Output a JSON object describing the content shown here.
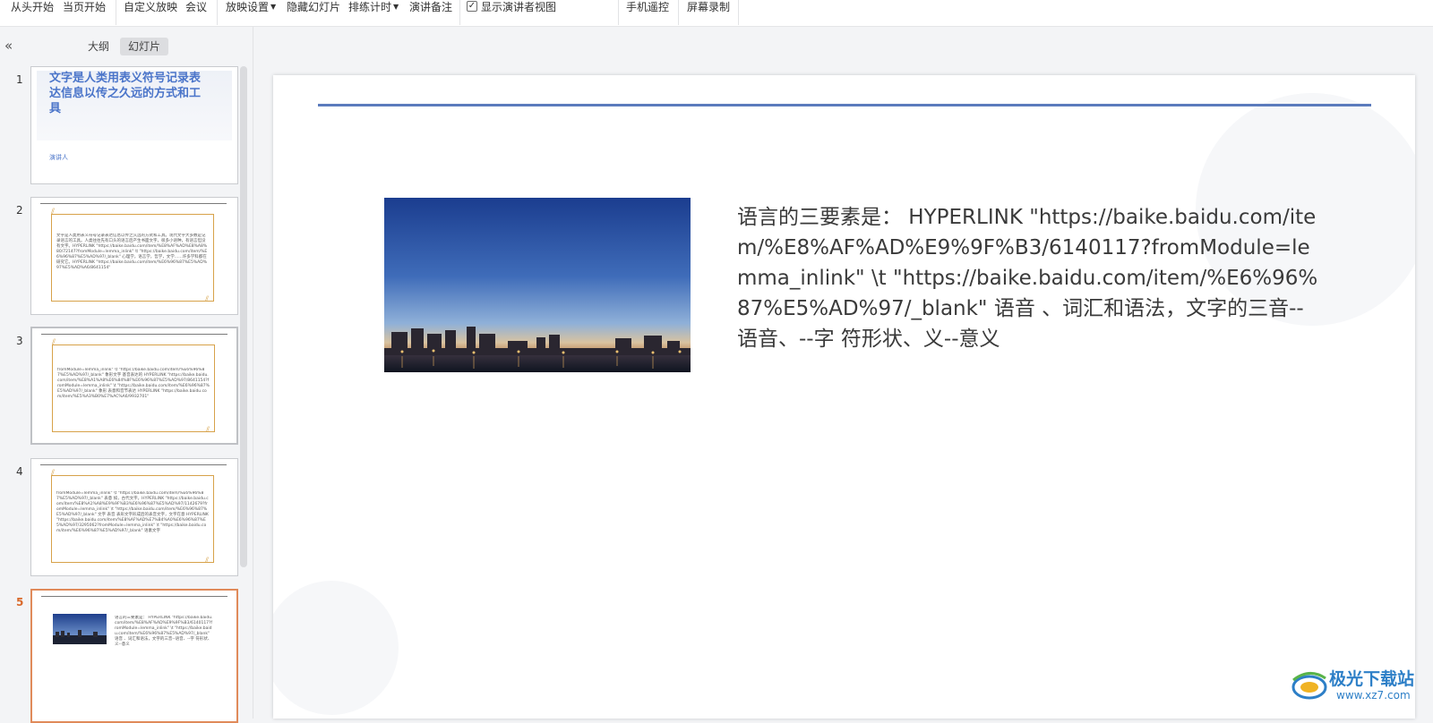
{
  "toolbar": {
    "items": [
      "从头开始",
      "当页开始",
      "自定义放映",
      "会议",
      "放映设置",
      "隐藏幻灯片",
      "排练计时",
      "演讲备注",
      "显示演讲者视图",
      "手机遥控",
      "屏幕录制"
    ],
    "presenter_view_checked": true
  },
  "panel": {
    "tab_outline": "大纲",
    "tab_slides": "幻灯片",
    "slides": [
      {
        "number": "1",
        "title": "文字是人类用表义符号记录表达信息以传之久远的方式和工具",
        "author": "演讲人"
      },
      {
        "number": "2",
        "text": "文字是人类用表义符号记录表达信息以传之久远的方式和工具。现代文字大多数是记录语言的工具。人类往往先有口头的语言后产生书面文字，很多小语种，有语言但没有文字。HYPERLINK \"https://baike.baidu.com/item/%E8%AF%AD%E8%A8%80/72147?fromModule=lemma_inlink\" \\t \"https://baike.baidu.com/item/%E6%96%87%E5%AD%97/_blank\" 心理学，语言学，哲学，文学……许多学科都在研究它。HYPERLINK \"https://baike.baidu.com/item/%E6%96%87%E5%AD%97%E5%AD%A6/8641154\""
      },
      {
        "number": "3",
        "text": "fromModule=lemma_inlink\" \\t \"https://baike.baidu.com/item/%E6%96%87%E5%AD%97/_blank\" 象形文字 基音表达的 HYPERLINK \"https://baike.baidu.com/item/%E8%A1%A8%E6%84%8F%E6%96%87%E5%AD%97/8641154?fromModule=lemma_inlink\" \\t \"https://baike.baidu.com/item/%E6%96%87%E5%AD%97/_blank\" 象形 表意和音节表达 HYPERLINK \"https://baike.baidu.com/item/%E5%A3%B0%E7%AC%A6/9932701\""
      },
      {
        "number": "4",
        "text": "fromModule=lemma_inlink\" \\t \"https://baike.baidu.com/item/%E6%96%87%E5%AD%97/_blank\" 表意 如，古代文字。HYPERLINK \"https://baike.baidu.com/item/%E8%A1%A8%E9%9F%B3%E6%96%87%E5%AD%97/1142679?fromModule=lemma_inlink\" \\t \"https://baike.baidu.com/item/%E6%96%87%E5%AD%97/_blank\" 文字 表音 表形文字形成后的表音文字，文字在意 HYPERLINK \"https://baike.baidu.com/item/%E8%AF%AD%E7%B4%A0%E6%96%87%E5%AD%97/3295062?fromModule=lemma_inlink\" \\t \"https://baike.baidu.com/item/%E6%96%87%E5%AD%97/_blank\" 语素文字"
      },
      {
        "number": "5",
        "text": "语言的三要素是： HYPERLINK \"https://baike.baidu.com/item/%E8%AF%AD%E9%9F%B3/6140117?fromModule=lemma_inlink\" \\t \"https://baike.baidu.com/item/%E6%96%87%E5%AD%97/_blank\" 语音 、词汇和语法，文字的三音--语音、--字 符形状、义--意义"
      }
    ]
  },
  "slide": {
    "body": "语言的三要素是： HYPERLINK \"https://baike.baidu.com/item/%E8%AF%AD%E9%9F%B3/6140117?fromModule=lemma_inlink\" \\t \"https://baike.baidu.com/item/%E6%96%87%E5%AD%97/_blank\" 语音 、词汇和语法，文字的三音--语音、--字 符形状、义--意义"
  },
  "watermark": {
    "name": "极光下载站",
    "url": "www.xz7.com"
  },
  "colors": {
    "accent_line": "#5b7bbd",
    "frame": "#d7a24a",
    "current_slide": "#e08a5a",
    "title_blue": "#4a74c9"
  }
}
